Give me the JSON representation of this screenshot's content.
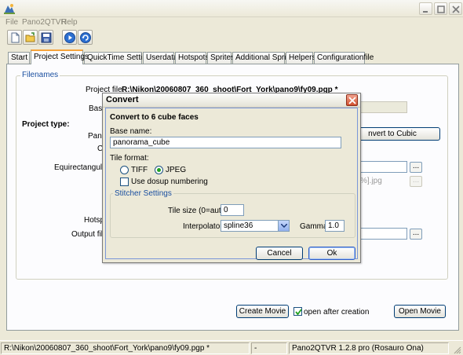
{
  "window": {
    "menu": [
      "File",
      "Pano2QTVR",
      "Help"
    ]
  },
  "toolbar": {
    "buttons": [
      "new-file-icon",
      "open-folder-icon",
      "save-icon",
      "play-icon",
      "refresh-icon"
    ]
  },
  "tabs": [
    "Start",
    "Project Settings",
    "QuickTime Settings",
    "Userdata",
    "Hotspots",
    "Sprites",
    "Additional Sprites",
    "Helpers",
    "Configurationfile"
  ],
  "active_tab": "Project Settings",
  "project": {
    "filenames_group": "Filenames",
    "project_file_label": "Project file:",
    "project_file_value": "R:\\Nikon\\20060807_360_shoot\\Fort_York\\pano9\\fy09.pgp *",
    "base_label": "Base",
    "project_type_label": "Project type:",
    "pano_label": "Pano",
    "c_label": "C",
    "convert_to_cubic_button": "nvert to Cubic",
    "equirect_label": "Equirectangular i",
    "pattern_fragment": "%].jpg",
    "hotspot_label": "Hotsp",
    "output_file_label": "Output file",
    "browse_label": "...",
    "create_movie_button": "Create Movie",
    "open_after_creation_label": "open after creation",
    "open_after_creation_checked": true,
    "open_movie_button": "Open Movie"
  },
  "dialog": {
    "title": "Convert",
    "heading": "Convert to 6 cube faces",
    "base_name_label": "Base name:",
    "base_name_value": "panorama_cube",
    "tile_format_label": "Tile format:",
    "tile_formats": [
      "TIFF",
      "JPEG"
    ],
    "tile_format_selected": "JPEG",
    "use_dosup_label": "Use dosup numbering",
    "use_dosup_checked": false,
    "stitcher_group": "Stitcher Settings",
    "tile_size_label": "Tile size (0=auto):",
    "tile_size_value": "0",
    "interpolator_label": "Interpolator:",
    "interpolator_value": "spline36",
    "gamma_label": "Gamma:",
    "gamma_value": "1.0",
    "cancel_button": "Cancel",
    "ok_button": "Ok"
  },
  "statusbar": {
    "path": "R:\\Nikon\\20060807_360_shoot\\Fort_York\\pano9\\fy09.pgp *",
    "separator": "-",
    "version": "Pano2QTVR 1.2.8 pro (Rosauro Ona)"
  }
}
